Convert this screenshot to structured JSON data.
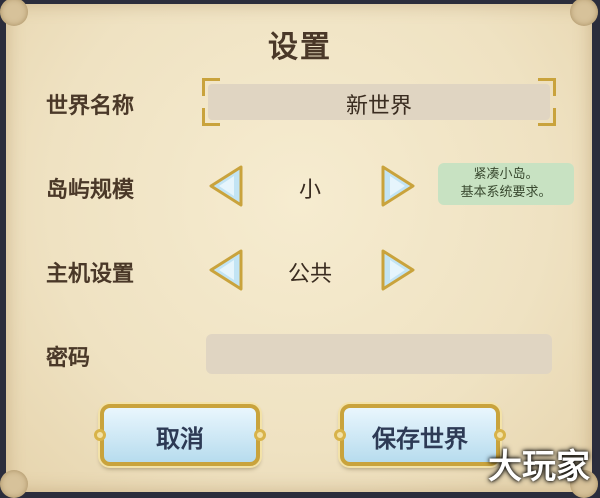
{
  "title": "设置",
  "world_name": {
    "label": "世界名称",
    "value": "新世界"
  },
  "island_size": {
    "label": "岛屿规模",
    "value": "小",
    "tooltip_line1": "紧凑小岛。",
    "tooltip_line2": "基本系统要求。"
  },
  "host_setting": {
    "label": "主机设置",
    "value": "公共"
  },
  "password": {
    "label": "密码",
    "value": ""
  },
  "buttons": {
    "cancel": "取消",
    "save": "保存世界"
  },
  "watermark": "大玩家",
  "colors": {
    "parchment": "#efe2c2",
    "button": "#b7dcee",
    "gold": "#c9a33c",
    "text": "#4a3828"
  }
}
